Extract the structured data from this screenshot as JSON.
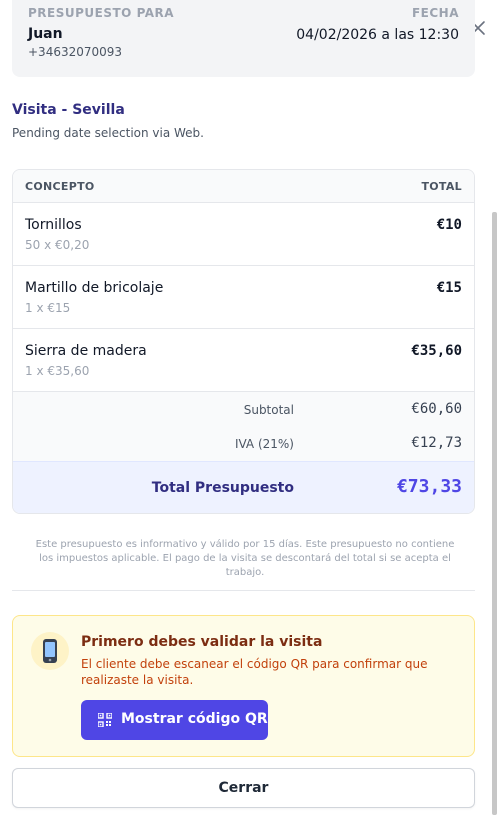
{
  "header": {
    "recipient_label": "PRESUPUESTO PARA",
    "date_label": "FECHA",
    "client_name": "Juan",
    "client_phone": "+34632070093",
    "date_value": "04/02/2026 a las 12:30"
  },
  "visit": {
    "title": "Visita - Sevilla",
    "subtitle": "Pending date selection via Web."
  },
  "table": {
    "col_concept": "CONCEPTO",
    "col_total": "TOTAL",
    "rows": [
      {
        "name": "Tornillos",
        "detail": "50 x €0,20",
        "total": "€10"
      },
      {
        "name": "Martillo de bricolaje",
        "detail": "1 x €15",
        "total": "€15"
      },
      {
        "name": "Sierra de madera",
        "detail": "1 x €35,60",
        "total": "€35,60"
      }
    ],
    "subtotal_label": "Subtotal",
    "subtotal_value": "€60,60",
    "tax_label": "IVA (21%)",
    "tax_value": "€12,73",
    "total_label": "Total Presupuesto",
    "total_value": "€73,33"
  },
  "disclaimer": "Este presupuesto es informativo y válido por 15 días. Este presupuesto no contiene los impuestos aplicable. El pago de la visita se descontará del total si se acepta el trabajo.",
  "qr_notice": {
    "icon": "mobile-phone-icon",
    "title": "Primero debes validar la visita",
    "text": "El cliente debe escanear el código QR para confirmar que realizaste la visita.",
    "button_icon": "qr-code-icon",
    "button_label": "Mostrar código QR"
  },
  "footer": {
    "close_label": "Cerrar"
  },
  "colors": {
    "accent": "#4f46e5",
    "heading": "#312e81",
    "warning_bg": "#fefce8",
    "warning_text": "#c2410c"
  }
}
